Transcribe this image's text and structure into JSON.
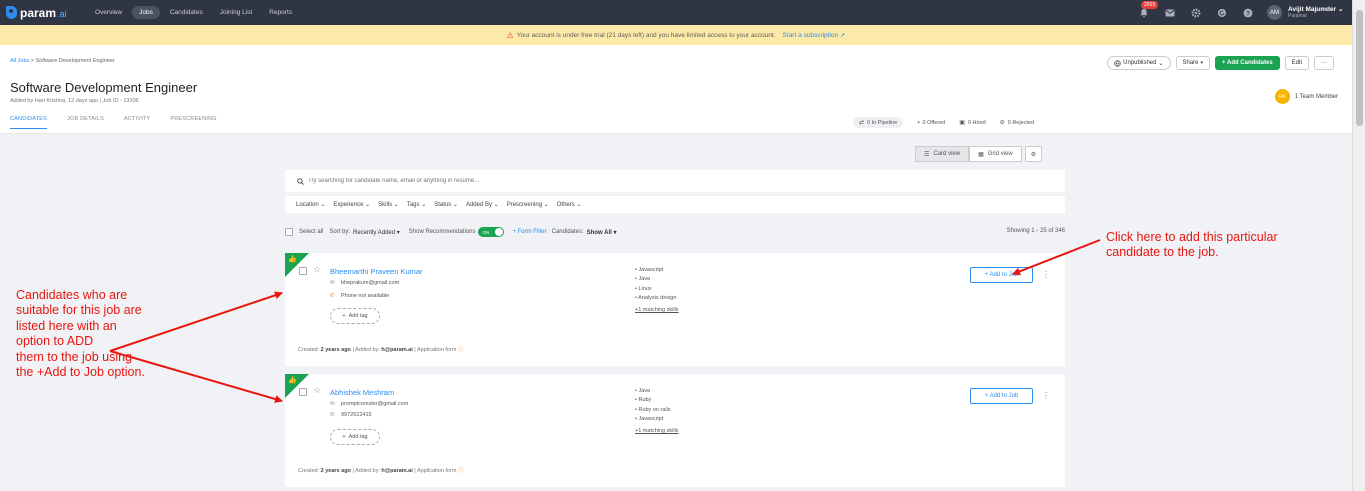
{
  "nav": {
    "brand": "param",
    "brand_suffix": ".ai",
    "links": [
      "Overview",
      "Jobs",
      "Candidates",
      "Joining List",
      "Reports"
    ],
    "notif_count": "2659",
    "avatar_initials": "AM",
    "user_name": "Avijit Majumder",
    "user_org": "Paramai"
  },
  "alert": {
    "text": "Your account is under free trial (21 days left) and you have limited access to your account.",
    "link": "Start a subscription"
  },
  "header": {
    "breadcrumb_root": "All Jobs",
    "breadcrumb_sep": ">",
    "breadcrumb_current": "Software Development Engineer",
    "title": "Software Development Engineer",
    "meta": "Added by Hari Krishna, 12 days ago   |   Job ID - 13106",
    "tabs": [
      "CANDIDATES",
      "JOB DETAILS",
      "ACTIVITY",
      "PRESCREENING"
    ],
    "buttons": {
      "status": "Unpublished",
      "share": "Share",
      "add": "+ Add Candidates",
      "edit": "Edit",
      "more": "···"
    },
    "team_initials": "HK",
    "team_label": "1 Team Member",
    "stats": [
      "0 In Pipeline",
      "0 Offered",
      "0 Hired",
      "0 Rejected"
    ]
  },
  "view": {
    "card": "Card view",
    "grid": "Grid view"
  },
  "search": {
    "placeholder": "Try searching for candidate name, email or anything in resume..."
  },
  "filters": [
    "Location",
    "Experience",
    "Skills",
    "Tags",
    "Status",
    "Added By",
    "Prescreening",
    "Others"
  ],
  "sort": {
    "select_all": "Select all",
    "sort_by_label": "Sort by:",
    "sort_by_value": "Recently Added",
    "recommend": "Show Recommendations",
    "toggle": "ON",
    "form_filter": "+ Form Filter",
    "cand_label": "Candidates:",
    "cand_value": "Show All",
    "showing": "Showing 1 - 25 of 346"
  },
  "candidates": [
    {
      "name": "Bheemarthi Praveen Kumar",
      "email": "bheprakum@gmail.com",
      "phone": "Phone not available",
      "skills": [
        "Javascript",
        "Java",
        "Linux",
        "Analysis design"
      ],
      "more_skills": "+1 matching skills",
      "add_tag": "Add tag",
      "add_job": "+ Add to Job",
      "created_label": "Created:",
      "created": "2 years ago",
      "added_by_label": "Added by:",
      "added_by": "h@param.ai",
      "source": "Application form"
    },
    {
      "name": "Abhishek Meshram",
      "email": "promptcomster@gmail.com",
      "phone": "9972622415",
      "skills": [
        "Java",
        "Ruby",
        "Ruby on rails",
        "Javascript"
      ],
      "more_skills": "+1 matching skills",
      "add_tag": "Add tag",
      "add_job": "+ Add to Job",
      "created_label": "Created:",
      "created": "2 years ago",
      "added_by_label": "Added by:",
      "added_by": "h@param.ai",
      "source": "Application form"
    }
  ],
  "annotations": {
    "left": [
      "Candidates who are",
      "suitable for this job are",
      "listed here with an",
      "option to  ADD",
      "them to the job using",
      "the +Add to Job option."
    ],
    "right": [
      "Click here to add this particular",
      "candidate to the job."
    ]
  },
  "colors": {
    "accent": "#2d8cf0",
    "brand_green": "#1aa350",
    "annotation": "#e8160f",
    "alert_bg": "#fdeaa8"
  }
}
